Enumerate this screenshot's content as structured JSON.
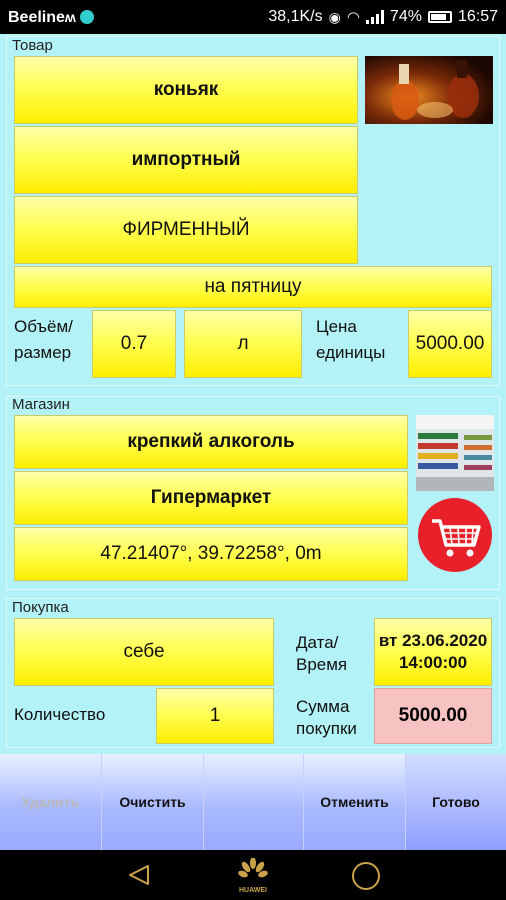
{
  "status_bar": {
    "carrier": "Beeline",
    "speed": "38,1K/s",
    "battery": "74%",
    "time": "16:57"
  },
  "product": {
    "section_label": "Товар",
    "name": "коньяк",
    "origin": "импортный",
    "brand": "ФИРМЕННЫЙ",
    "note": "на пятницу",
    "volume_label_1": "Объём/",
    "volume_label_2": "размер",
    "volume_value": "0.7",
    "unit": "л",
    "price_label_1": "Цена",
    "price_label_2": "единицы",
    "price_value": "5000.00"
  },
  "store": {
    "section_label": "Магазин",
    "category": "крепкий алкоголь",
    "name": "Гипермаркет",
    "coords": "47.21407°, 39.72258°, 0m"
  },
  "purchase": {
    "section_label": "Покупка",
    "for_whom": "себе",
    "datetime_label_1": "Дата/",
    "datetime_label_2": "Время",
    "date": "вт 23.06.2020",
    "time": "14:00:00",
    "quantity_label": "Количество",
    "quantity_value": "1",
    "sum_label_1": "Сумма",
    "sum_label_2": "покупки",
    "sum_value": "5000.00"
  },
  "actions": {
    "delete": "Удалить",
    "clear": "Очистить",
    "cancel": "Отменить",
    "done": "Готово"
  },
  "nav": {
    "brand": "HUAWEI"
  },
  "colors": {
    "background": "#b3f2f7",
    "button_yellow": "#ffee00",
    "sum_pink": "#f7c2c2",
    "cart_red": "#e8202a",
    "actionbar_blue": "#9aaaff"
  }
}
